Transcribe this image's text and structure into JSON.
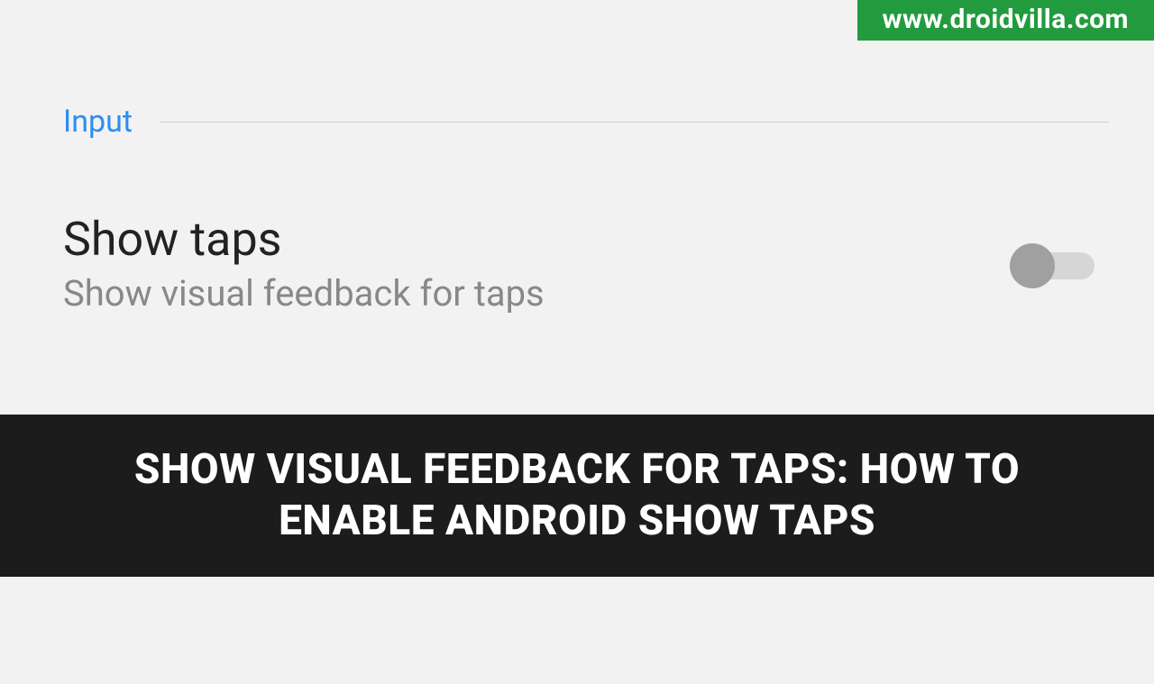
{
  "watermark": {
    "text": "www.droidvilla.com"
  },
  "section": {
    "title": "Input"
  },
  "setting": {
    "title": "Show taps",
    "subtitle": "Show visual feedback for taps",
    "toggle_state": "off"
  },
  "banner": {
    "text": "SHOW VISUAL FEEDBACK FOR TAPS: HOW TO ENABLE ANDROID SHOW TAPS"
  },
  "colors": {
    "watermark_bg": "#229b3e",
    "section_title": "#2b8ef0",
    "banner_bg": "#1c1c1c"
  }
}
